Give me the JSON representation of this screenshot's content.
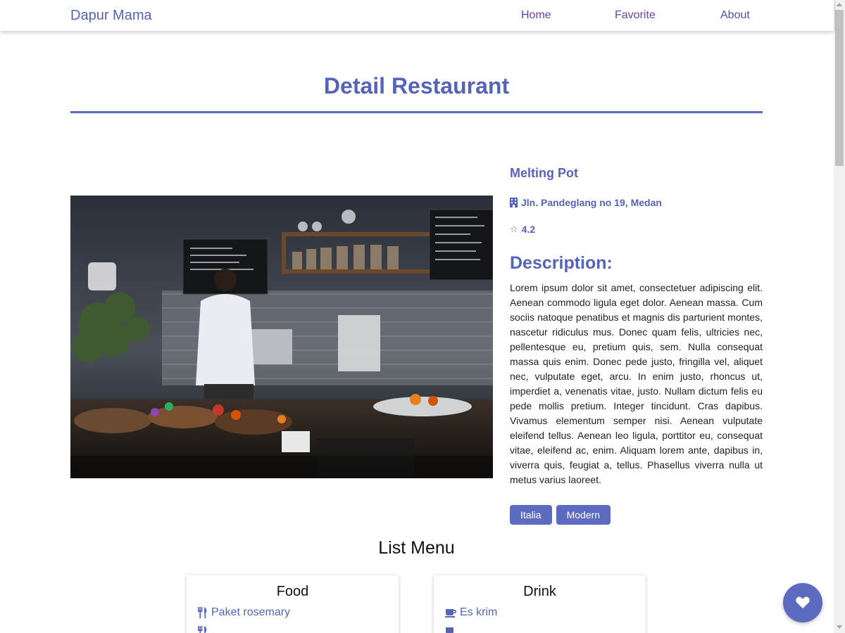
{
  "nav": {
    "brand": "Dapur Mama",
    "links": [
      "Home",
      "Favorite",
      "About"
    ]
  },
  "page": {
    "title": "Detail Restaurant"
  },
  "restaurant": {
    "name": "Melting Pot",
    "address": "Jln. Pandeglang no 19, Medan",
    "rating": "4.2",
    "description_heading": "Description:",
    "description": "Lorem ipsum dolor sit amet, consectetuer adipiscing elit. Aenean commodo ligula eget dolor. Aenean massa. Cum sociis natoque penatibus et magnis dis parturient montes, nascetur ridiculus mus. Donec quam felis, ultricies nec, pellentesque eu, pretium quis, sem. Nulla consequat massa quis enim. Donec pede justo, fringilla vel, aliquet nec, vulputate eget, arcu. In enim justo, rhoncus ut, imperdiet a, venenatis vitae, justo. Nullam dictum felis eu pede mollis pretium. Integer tincidunt. Cras dapibus. Vivamus elementum semper nisi. Aenean vulputate eleifend tellus. Aenean leo ligula, porttitor eu, consequat vitae, eleifend ac, enim. Aliquam lorem ante, dapibus in, viverra quis, feugiat a, tellus. Phasellus viverra nulla ut metus varius laoreet.",
    "categories": [
      "Italia",
      "Modern"
    ]
  },
  "menu": {
    "heading": "List Menu",
    "food": {
      "title": "Food",
      "items": [
        "Paket rosemary"
      ]
    },
    "drink": {
      "title": "Drink",
      "items": [
        "Es krim"
      ]
    }
  },
  "icons": {
    "address": "building-icon",
    "rating": "star-icon",
    "food": "utensils-icon",
    "drink": "coffee-cup-icon",
    "favorite": "heart-icon"
  },
  "colors": {
    "accent": "#5c6bc0",
    "brand_text": "#5564b8",
    "nav_link": "#6f3fa6"
  }
}
